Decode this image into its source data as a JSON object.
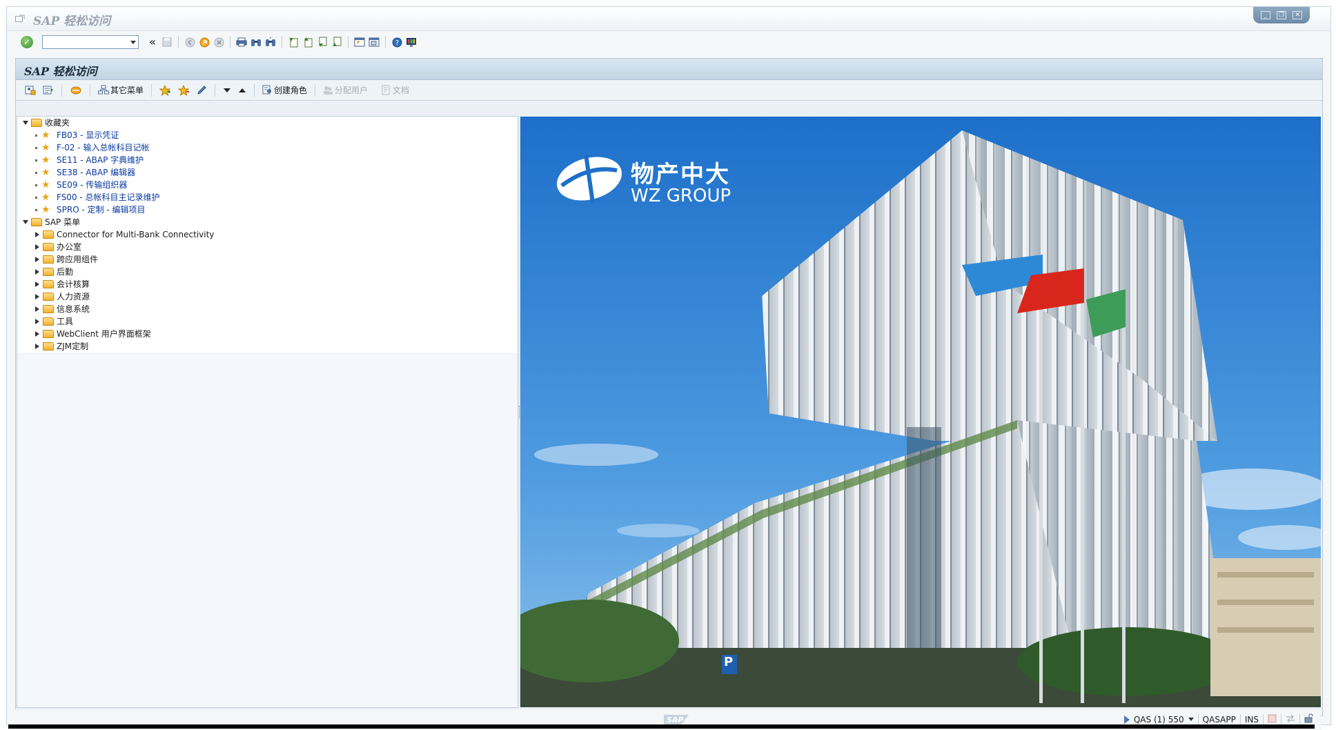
{
  "window": {
    "title": "SAP 轻松访问",
    "controls": [
      "_",
      "❐",
      "✕"
    ]
  },
  "system_toolbar": {
    "command_field_value": ""
  },
  "app": {
    "title": "SAP 轻松访问",
    "toolbar": {
      "other_menu": "其它菜单",
      "create_role": "创建角色",
      "assign_users": "分配用户",
      "documentation": "文档"
    }
  },
  "tree": {
    "favorites_label": "收藏夹",
    "favorites": [
      "FB03 - 显示凭证",
      "F-02 - 输入总帐科目记帐",
      "SE11 - ABAP 字典维护",
      "SE38 - ABAP 编辑器",
      "SE09 - 传输组织器",
      "FS00 - 总帐科目主记录维护",
      "SPRO - 定制 - 编辑项目"
    ],
    "sap_menu_label": "SAP 菜单",
    "sap_menu": [
      "Connector for Multi-Bank Connectivity",
      "办公室",
      "跨应用组件",
      "后勤",
      "会计核算",
      "人力资源",
      "信息系统",
      "工具",
      "WebClient 用户界面框架",
      "ZJM定制"
    ]
  },
  "picture": {
    "logo_cn": "物产中大",
    "logo_en": "WZ GROUP",
    "parking_sign": "P"
  },
  "statusbar": {
    "sap_logo": "SAP",
    "system": "QAS (1) 550",
    "server": "QASAPP",
    "mode": "INS"
  },
  "colors": {
    "sky_top": "#1d6fc9",
    "sky_bottom": "#8ec3ec",
    "folder": "#f2b230",
    "favorite_text": "#0a3aa0"
  }
}
